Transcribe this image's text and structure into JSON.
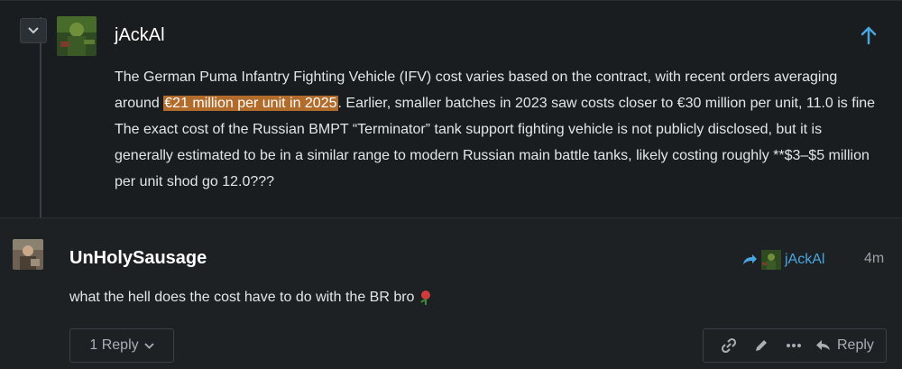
{
  "quote": {
    "author": "jAckAl",
    "collapse_icon": "chevron-down-icon",
    "up_icon": "arrow-up-icon",
    "text_before": "The German Puma Infantry Fighting Vehicle (IFV) cost varies based on the contract, with recent orders averaging around ",
    "text_highlight": "€21 million per unit in 2025",
    "text_after": ". Earlier, smaller batches in 2023 saw costs closer to €30 million per unit, 11.0 is fine The exact cost of the Russian BMPT “Terminator” tank support fighting vehicle is not publicly disclosed, but it is generally estimated to be in a similar range to modern Russian main battle tanks, likely costing roughly **$3–$5 million per unit shod go 12.0???"
  },
  "post": {
    "author": "UnHolySausage",
    "reply_to_name": "jAckAl",
    "time": "4m",
    "body": "what the hell does the cost have to do with the BR bro",
    "emoji_icon": "rose-icon"
  },
  "replies": {
    "label": "1 Reply"
  },
  "actions": {
    "reply_label": "Reply",
    "icons": [
      "link-icon",
      "edit-icon",
      "more-icon",
      "reply-icon"
    ]
  },
  "colors": {
    "background": "#1d2124",
    "highlight": "#b16b2a",
    "link": "#4aa6e0",
    "muted": "#9aa1a6"
  }
}
